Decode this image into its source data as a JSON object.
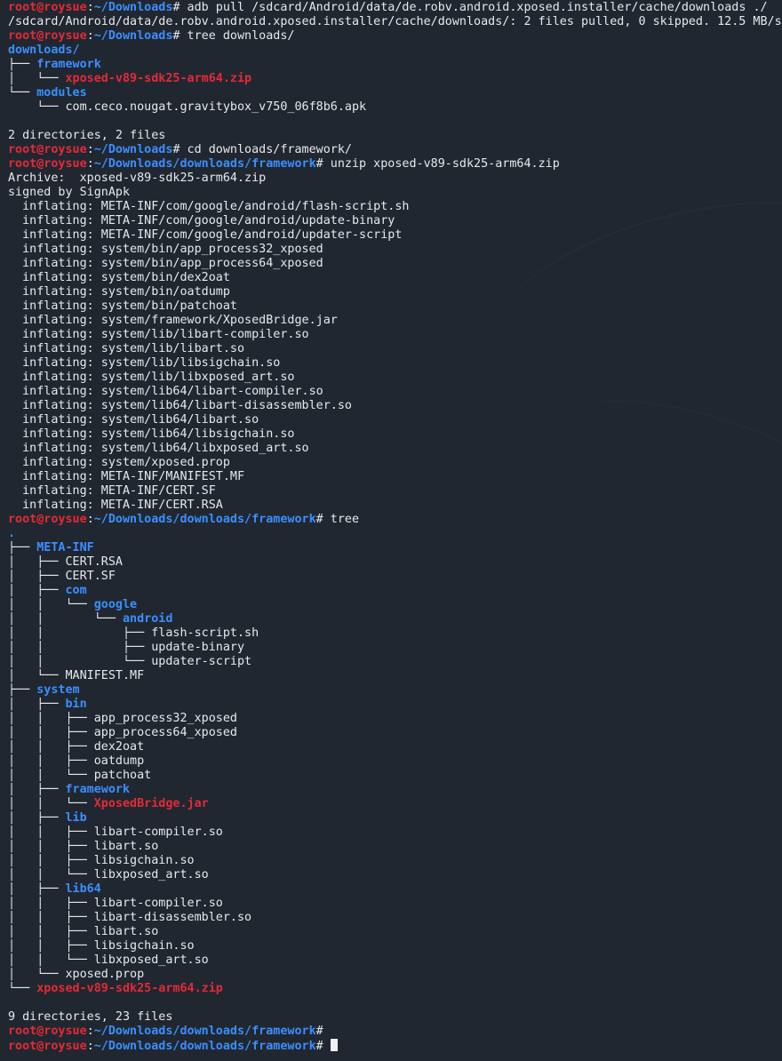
{
  "terminal": {
    "prompt": {
      "user_host": "root@roysue",
      "colon": ":",
      "sep": "#"
    },
    "lines": [
      {
        "type": "prompt",
        "path": "~/Downloads",
        "cmd": " adb pull /sdcard/Android/data/de.robv.android.xposed.installer/cache/downloads ./"
      },
      {
        "type": "text",
        "text": "/sdcard/Android/data/de.robv.android.xposed.installer/cache/downloads/: 2 files pulled, 0 skipped. 12.5 MB/s"
      },
      {
        "type": "prompt",
        "path": "~/Downloads",
        "cmd": " tree downloads/"
      },
      {
        "type": "entry",
        "prefix": "",
        "name": "downloads/",
        "kind": "dir"
      },
      {
        "type": "entry",
        "prefix": "├── ",
        "name": "framework",
        "kind": "dir"
      },
      {
        "type": "entry",
        "prefix": "│   └── ",
        "name": "xposed-v89-sdk25-arm64.zip",
        "kind": "zip"
      },
      {
        "type": "entry",
        "prefix": "└── ",
        "name": "modules",
        "kind": "dir"
      },
      {
        "type": "entry",
        "prefix": "    └── ",
        "name": "com.ceco.nougat.gravitybox_v750_06f8b6.apk",
        "kind": "file"
      },
      {
        "type": "text",
        "text": ""
      },
      {
        "type": "text",
        "text": "2 directories, 2 files"
      },
      {
        "type": "prompt",
        "path": "~/Downloads",
        "cmd": " cd downloads/framework/"
      },
      {
        "type": "prompt",
        "path": "~/Downloads/downloads/framework",
        "cmd": " unzip xposed-v89-sdk25-arm64.zip"
      },
      {
        "type": "text",
        "text": "Archive:  xposed-v89-sdk25-arm64.zip"
      },
      {
        "type": "text",
        "text": "signed by SignApk"
      },
      {
        "type": "text",
        "text": "  inflating: META-INF/com/google/android/flash-script.sh"
      },
      {
        "type": "text",
        "text": "  inflating: META-INF/com/google/android/update-binary"
      },
      {
        "type": "text",
        "text": "  inflating: META-INF/com/google/android/updater-script"
      },
      {
        "type": "text",
        "text": "  inflating: system/bin/app_process32_xposed"
      },
      {
        "type": "text",
        "text": "  inflating: system/bin/app_process64_xposed"
      },
      {
        "type": "text",
        "text": "  inflating: system/bin/dex2oat"
      },
      {
        "type": "text",
        "text": "  inflating: system/bin/oatdump"
      },
      {
        "type": "text",
        "text": "  inflating: system/bin/patchoat"
      },
      {
        "type": "text",
        "text": "  inflating: system/framework/XposedBridge.jar"
      },
      {
        "type": "text",
        "text": "  inflating: system/lib/libart-compiler.so"
      },
      {
        "type": "text",
        "text": "  inflating: system/lib/libart.so"
      },
      {
        "type": "text",
        "text": "  inflating: system/lib/libsigchain.so"
      },
      {
        "type": "text",
        "text": "  inflating: system/lib/libxposed_art.so"
      },
      {
        "type": "text",
        "text": "  inflating: system/lib64/libart-compiler.so"
      },
      {
        "type": "text",
        "text": "  inflating: system/lib64/libart-disassembler.so"
      },
      {
        "type": "text",
        "text": "  inflating: system/lib64/libart.so"
      },
      {
        "type": "text",
        "text": "  inflating: system/lib64/libsigchain.so"
      },
      {
        "type": "text",
        "text": "  inflating: system/lib64/libxposed_art.so"
      },
      {
        "type": "text",
        "text": "  inflating: system/xposed.prop"
      },
      {
        "type": "text",
        "text": "  inflating: META-INF/MANIFEST.MF"
      },
      {
        "type": "text",
        "text": "  inflating: META-INF/CERT.SF"
      },
      {
        "type": "text",
        "text": "  inflating: META-INF/CERT.RSA"
      },
      {
        "type": "prompt",
        "path": "~/Downloads/downloads/framework",
        "cmd": " tree"
      },
      {
        "type": "entry",
        "prefix": "",
        "name": ".",
        "kind": "dir"
      },
      {
        "type": "entry",
        "prefix": "├── ",
        "name": "META-INF",
        "kind": "dir"
      },
      {
        "type": "entry",
        "prefix": "│   ├── ",
        "name": "CERT.RSA",
        "kind": "file"
      },
      {
        "type": "entry",
        "prefix": "│   ├── ",
        "name": "CERT.SF",
        "kind": "file"
      },
      {
        "type": "entry",
        "prefix": "│   ├── ",
        "name": "com",
        "kind": "dir"
      },
      {
        "type": "entry",
        "prefix": "│   │   └── ",
        "name": "google",
        "kind": "dir"
      },
      {
        "type": "entry",
        "prefix": "│   │       └── ",
        "name": "android",
        "kind": "dir"
      },
      {
        "type": "entry",
        "prefix": "│   │           ├── ",
        "name": "flash-script.sh",
        "kind": "file"
      },
      {
        "type": "entry",
        "prefix": "│   │           ├── ",
        "name": "update-binary",
        "kind": "file"
      },
      {
        "type": "entry",
        "prefix": "│   │           └── ",
        "name": "updater-script",
        "kind": "file"
      },
      {
        "type": "entry",
        "prefix": "│   └── ",
        "name": "MANIFEST.MF",
        "kind": "file"
      },
      {
        "type": "entry",
        "prefix": "├── ",
        "name": "system",
        "kind": "dir"
      },
      {
        "type": "entry",
        "prefix": "│   ├── ",
        "name": "bin",
        "kind": "dir"
      },
      {
        "type": "entry",
        "prefix": "│   │   ├── ",
        "name": "app_process32_xposed",
        "kind": "file"
      },
      {
        "type": "entry",
        "prefix": "│   │   ├── ",
        "name": "app_process64_xposed",
        "kind": "file"
      },
      {
        "type": "entry",
        "prefix": "│   │   ├── ",
        "name": "dex2oat",
        "kind": "file"
      },
      {
        "type": "entry",
        "prefix": "│   │   ├── ",
        "name": "oatdump",
        "kind": "file"
      },
      {
        "type": "entry",
        "prefix": "│   │   └── ",
        "name": "patchoat",
        "kind": "file"
      },
      {
        "type": "entry",
        "prefix": "│   ├── ",
        "name": "framework",
        "kind": "dir"
      },
      {
        "type": "entry",
        "prefix": "│   │   └── ",
        "name": "XposedBridge.jar",
        "kind": "zip"
      },
      {
        "type": "entry",
        "prefix": "│   ├── ",
        "name": "lib",
        "kind": "dir"
      },
      {
        "type": "entry",
        "prefix": "│   │   ├── ",
        "name": "libart-compiler.so",
        "kind": "file"
      },
      {
        "type": "entry",
        "prefix": "│   │   ├── ",
        "name": "libart.so",
        "kind": "file"
      },
      {
        "type": "entry",
        "prefix": "│   │   ├── ",
        "name": "libsigchain.so",
        "kind": "file"
      },
      {
        "type": "entry",
        "prefix": "│   │   └── ",
        "name": "libxposed_art.so",
        "kind": "file"
      },
      {
        "type": "entry",
        "prefix": "│   ├── ",
        "name": "lib64",
        "kind": "dir"
      },
      {
        "type": "entry",
        "prefix": "│   │   ├── ",
        "name": "libart-compiler.so",
        "kind": "file"
      },
      {
        "type": "entry",
        "prefix": "│   │   ├── ",
        "name": "libart-disassembler.so",
        "kind": "file"
      },
      {
        "type": "entry",
        "prefix": "│   │   ├── ",
        "name": "libart.so",
        "kind": "file"
      },
      {
        "type": "entry",
        "prefix": "│   │   ├── ",
        "name": "libsigchain.so",
        "kind": "file"
      },
      {
        "type": "entry",
        "prefix": "│   │   └── ",
        "name": "libxposed_art.so",
        "kind": "file"
      },
      {
        "type": "entry",
        "prefix": "│   └── ",
        "name": "xposed.prop",
        "kind": "file"
      },
      {
        "type": "entry",
        "prefix": "└── ",
        "name": "xposed-v89-sdk25-arm64.zip",
        "kind": "zip"
      },
      {
        "type": "text",
        "text": ""
      },
      {
        "type": "text",
        "text": "9 directories, 23 files"
      },
      {
        "type": "prompt",
        "path": "~/Downloads/downloads/framework",
        "cmd": ""
      },
      {
        "type": "prompt",
        "path": "~/Downloads/downloads/framework",
        "cmd": " ",
        "cursor": true
      }
    ]
  },
  "colors": {
    "background": "#212730",
    "text": "#e6e9ee",
    "prompt_user": "#e32a38",
    "directory": "#3a8fff",
    "archive": "#e32a38"
  }
}
